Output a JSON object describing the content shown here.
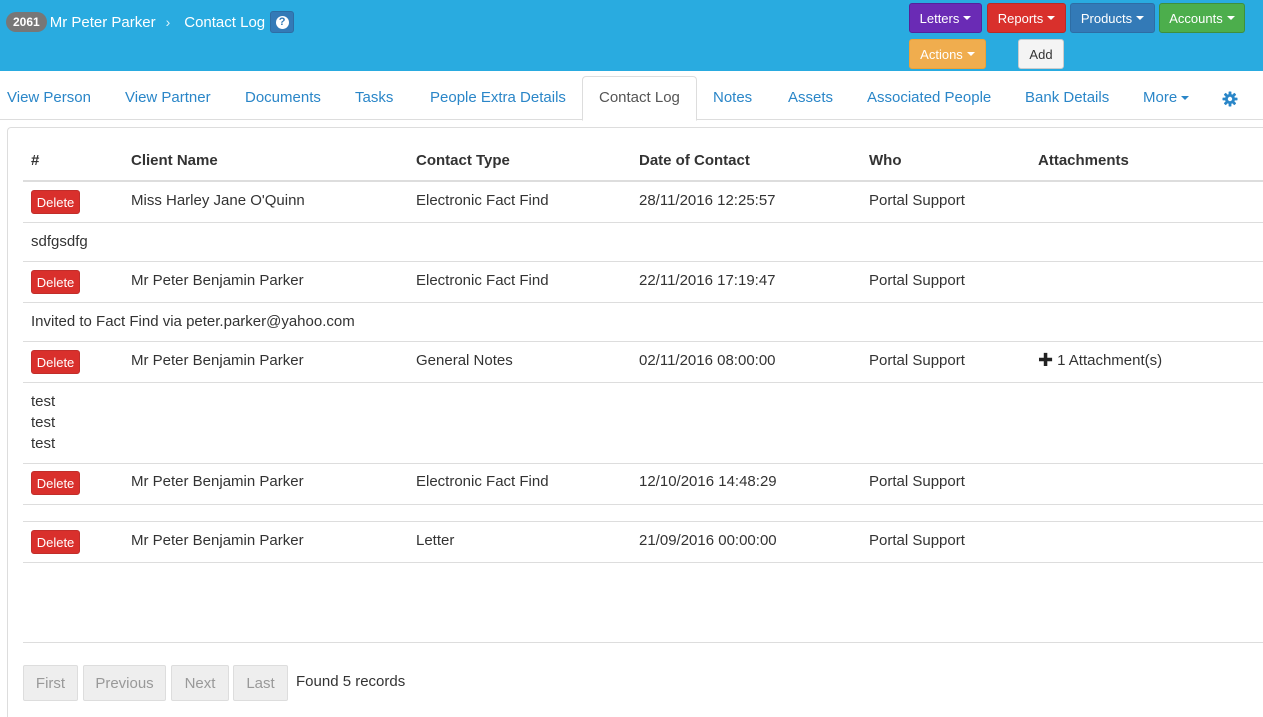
{
  "header": {
    "record_id": "2061",
    "person_name": "Mr Peter Parker",
    "breadcrumb_separator": "›",
    "page_title": "Contact Log",
    "help_glyph": "?",
    "buttons": {
      "letters": "Letters",
      "reports": "Reports",
      "products": "Products",
      "accounts": "Accounts",
      "actions": "Actions",
      "add": "Add"
    },
    "colors": {
      "bar": "#29abe0",
      "letters": "#6a2bb5",
      "reports": "#d9302c",
      "products": "#337ab7",
      "accounts": "#4cae4c",
      "actions": "#f0ad4e"
    }
  },
  "tabs": [
    {
      "label": "View Person"
    },
    {
      "label": "View Partner"
    },
    {
      "label": "Documents"
    },
    {
      "label": "Tasks"
    },
    {
      "label": "People Extra Details"
    },
    {
      "label": "Contact Log",
      "active": true
    },
    {
      "label": "Notes"
    },
    {
      "label": "Assets"
    },
    {
      "label": "Associated People"
    },
    {
      "label": "Bank Details"
    },
    {
      "label": "More"
    }
  ],
  "settings_icon": "gear-icon",
  "table": {
    "columns": [
      "#",
      "Client Name",
      "Contact Type",
      "Date of Contact",
      "Who",
      "Attachments"
    ],
    "delete_label": "Delete",
    "rows": [
      {
        "client": "Miss Harley Jane O'Quinn",
        "type": "Electronic Fact Find",
        "date": "28/11/2016 12:25:57",
        "who": "Portal Support",
        "attachments": "",
        "note": "sdfgsdfg"
      },
      {
        "client": "Mr Peter Benjamin Parker",
        "type": "Electronic Fact Find",
        "date": "22/11/2016 17:19:47",
        "who": "Portal Support",
        "attachments": "",
        "note": "Invited to Fact Find via peter.parker@yahoo.com"
      },
      {
        "client": "Mr Peter Benjamin Parker",
        "type": "General Notes",
        "date": "02/11/2016 08:00:00",
        "who": "Portal Support",
        "attachments": "1 Attachment(s)",
        "note_lines": [
          "test",
          "test",
          "test"
        ]
      },
      {
        "client": "Mr Peter Benjamin Parker",
        "type": "Electronic Fact Find",
        "date": "12/10/2016 14:48:29",
        "who": "Portal Support",
        "attachments": "",
        "note": ""
      },
      {
        "client": "Mr Peter Benjamin Parker",
        "type": "Letter",
        "date": "21/09/2016 00:00:00",
        "who": "Portal Support",
        "attachments": "",
        "note": ""
      }
    ]
  },
  "pager": {
    "first": "First",
    "previous": "Previous",
    "next": "Next",
    "last": "Last",
    "status": "Found 5 records"
  }
}
